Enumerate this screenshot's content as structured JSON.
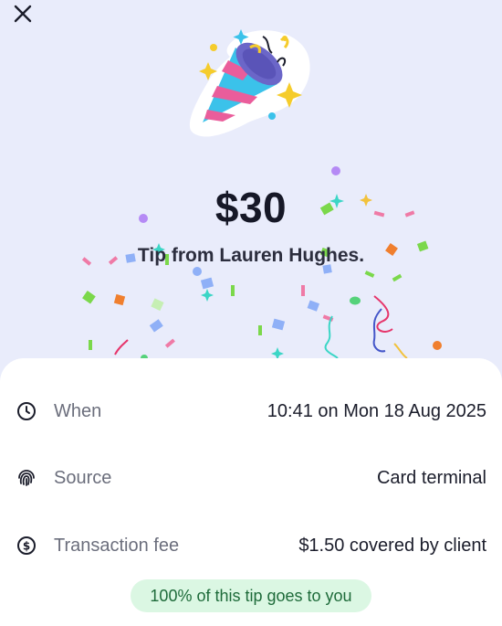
{
  "header": {
    "close_icon": "close-icon"
  },
  "hero": {
    "icon": "party-popper-icon",
    "amount": "$30",
    "subtitle": "Tip from Lauren Hughes."
  },
  "details": {
    "rows": [
      {
        "icon": "clock-icon",
        "label": "When",
        "value": "10:41 on Mon 18 Aug 2025"
      },
      {
        "icon": "fingerprint-icon",
        "label": "Source",
        "value": "Card terminal"
      },
      {
        "icon": "dollar-circle-icon",
        "label": "Transaction fee",
        "value": "$1.50 covered by client"
      }
    ]
  },
  "badge": {
    "text": "100% of this tip goes to you"
  },
  "colors": {
    "background": "#e9ecfb",
    "sheet": "#ffffff",
    "badge_bg": "#dbf7e3",
    "badge_text": "#1e6b3a",
    "confetti": [
      "#9b6cf0",
      "#f2c23c",
      "#3bd6c6",
      "#ef7aa6",
      "#f07f2e",
      "#7bd84b",
      "#8fb0f7",
      "#e6356b",
      "#4456c9"
    ]
  }
}
